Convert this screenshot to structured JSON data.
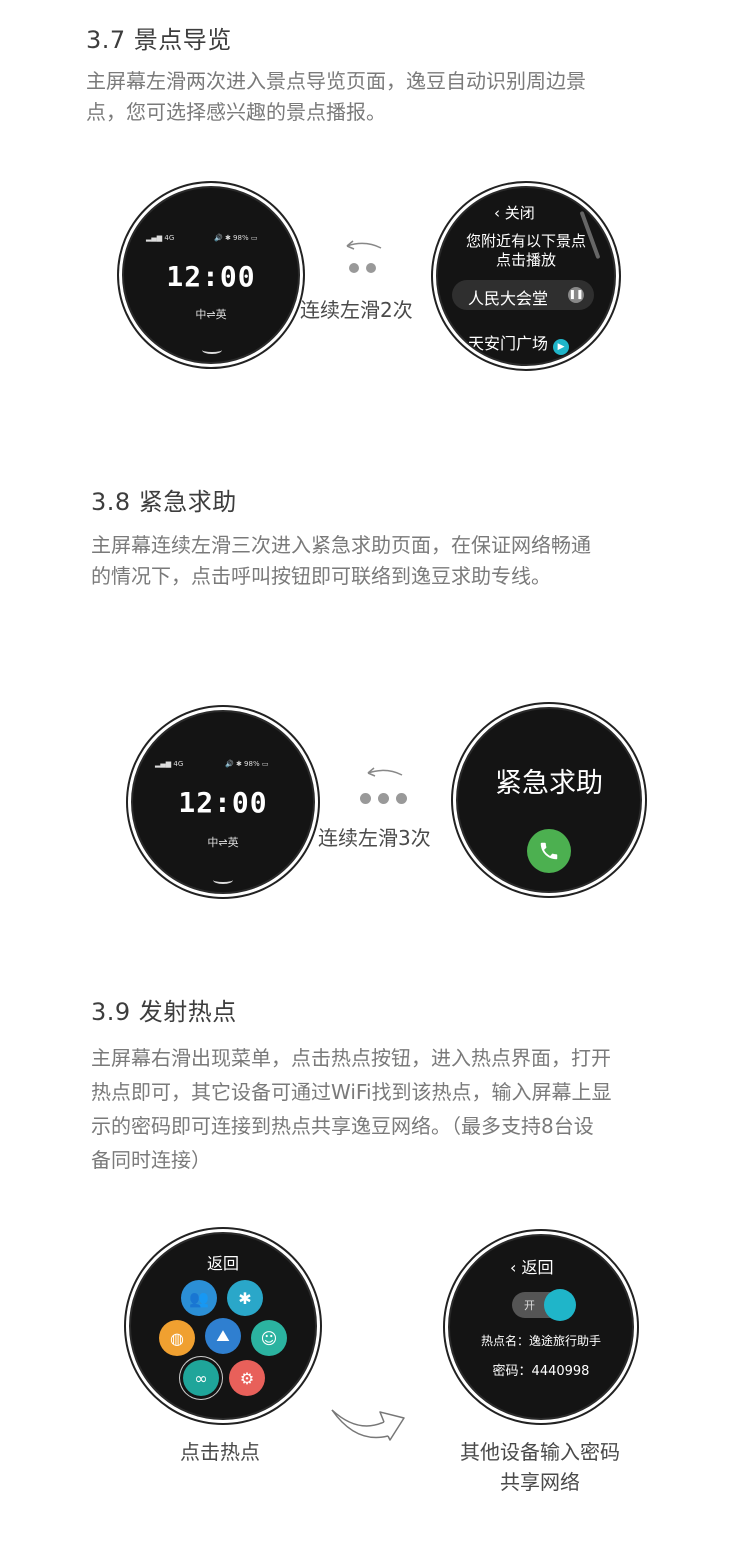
{
  "s37": {
    "heading": "3.7 景点导览",
    "para": [
      "主屏幕左滑两次进入景点导览页面，逸豆自动识别周边景",
      "点，您可选择感兴趣的景点播报。"
    ],
    "home": {
      "signal": "4G",
      "battery": "98%",
      "time": "12:00",
      "lang": "中⇌英"
    },
    "caption": "连续左滑2次",
    "guide": {
      "back": "关闭",
      "title1": "您附近有以下景点",
      "title2": "点击播放",
      "item1": "人民大会堂",
      "item2": "天安门广场"
    }
  },
  "s38": {
    "heading": "3.8 紧急求助",
    "para": [
      "主屏幕连续左滑三次进入紧急求助页面，在保证网络畅通",
      "的情况下，点击呼叫按钮即可联络到逸豆求助专线。"
    ],
    "home": {
      "signal": "4G",
      "battery": "98%",
      "time": "12:00",
      "lang": "中⇌英"
    },
    "caption": "连续左滑3次",
    "sos_title": "紧急求助"
  },
  "s39": {
    "heading": "3.9 发射热点",
    "para": [
      "主屏幕右滑出现菜单，点击热点按钮，进入热点界面，打开",
      "热点即可，其它设备可通过WiFi找到该热点，输入屏幕上显",
      "示的密码即可连接到热点共享逸豆网络。（最多支持8台设",
      "备同时连接）"
    ],
    "menu_back": "返回",
    "caption_left": "点击热点",
    "hotspot": {
      "back": "返回",
      "toggle": "开",
      "name": "热点名：逸途旅行助手",
      "password": "密码：4440998"
    },
    "caption_right1": "其他设备输入密码",
    "caption_right2": "共享网络"
  },
  "colors": {
    "call_green": "#4cb050",
    "toggle_teal": "#1fb5c9"
  }
}
